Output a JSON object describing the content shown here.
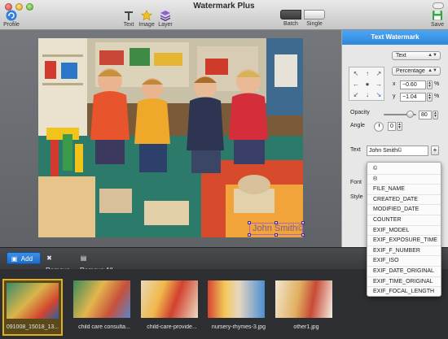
{
  "window": {
    "title": "Watermark Plus"
  },
  "toolbar": {
    "profile_label": "Profile",
    "text_label": "Text",
    "image_label": "Image",
    "layer_label": "Layer",
    "batch_label": "Batch",
    "single_label": "Single",
    "save_label": "Save",
    "mode_selected": "Batch"
  },
  "panel": {
    "header": "Text Watermark",
    "type_value": "Text",
    "position_unit": "Percentage",
    "x_label": "x",
    "x_value": "−0.60",
    "x_unit": "%",
    "y_label": "y",
    "y_value": "−1.04",
    "y_unit": "%",
    "opacity_label": "Opacity",
    "opacity_value": "80",
    "opacity_fraction": 0.8,
    "angle_label": "Angle",
    "angle_value": "0",
    "text_label": "Text",
    "text_value": "John Smith©",
    "text_add": "+",
    "font_label": "Font",
    "style_label": "Style"
  },
  "symbol_menu": {
    "items": [
      "©",
      "®",
      "FILE_NAME",
      "CREATED_DATE",
      "MODIFIED_DATE",
      "COUNTER",
      "EXIF_MODEL",
      "EXIF_EXPOSURE_TIME",
      "EXIF_F_NUMBER",
      "EXIF_ISO",
      "EXIF_DATE_ORIGINAL",
      "EXIF_TIME_ORIGINAL",
      "EXIF_FOCAL_LENGTH"
    ]
  },
  "canvas": {
    "watermark_text": "John Smith©"
  },
  "bottom": {
    "add_label": "Add",
    "remove_label": "Remove",
    "remove_all_label": "Remove All"
  },
  "thumbnails": [
    {
      "label": "091008_15018_13...",
      "selected": true
    },
    {
      "label": "child care consulta...",
      "selected": false
    },
    {
      "label": "child-care-provide...",
      "selected": false
    },
    {
      "label": "nursery-rhymes-3.jpg",
      "selected": false
    },
    {
      "label": "other1.jpg",
      "selected": false
    }
  ]
}
